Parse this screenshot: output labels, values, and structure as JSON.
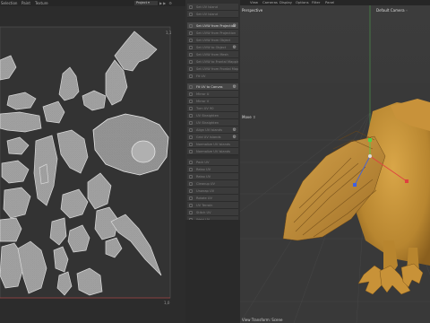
{
  "uv_menu": [
    "Selection",
    "Paint",
    "Texture"
  ],
  "uv_dropdown": "Project",
  "uv_buttons": "▶▶ ⚙",
  "uv_labels": {
    "corner_top": "1,1",
    "corner_bottom": "1,0"
  },
  "tools": [
    {
      "label": "Set UV Island"
    },
    {
      "label": "Set UV Island"
    },
    {
      "label": "Set UVW from Projection",
      "active": true
    },
    {
      "label": "Set UVW from Projection"
    },
    {
      "label": "Set UVW from Object"
    },
    {
      "label": "Set UVW to Object"
    },
    {
      "label": "Set UVW from Mesh"
    },
    {
      "label": "Set UVW to Frontal Mapping"
    },
    {
      "label": "Set UVW from Frontal Mapping"
    },
    {
      "label": "Fit UV"
    },
    {
      "label": "Fit UV to Canvas",
      "active": true
    },
    {
      "label": "Mirror U"
    },
    {
      "label": "Mirror V"
    },
    {
      "label": "Turn UV 90"
    },
    {
      "label": "UV Straighten"
    },
    {
      "label": "UV Straighten"
    },
    {
      "label": "Align UV Islands"
    },
    {
      "label": "Grid UV Islands"
    },
    {
      "label": "Normalize UV Islands"
    },
    {
      "label": "Normalize UV Islands"
    },
    {
      "label": "Pack UV"
    },
    {
      "label": "Relax UV"
    },
    {
      "label": "Relax UV"
    },
    {
      "label": "Cleanup UV"
    },
    {
      "label": "Unwrap UV"
    },
    {
      "label": "Rotate UV"
    },
    {
      "label": "UV Terrain"
    },
    {
      "label": "Stitch UV"
    },
    {
      "label": "Weld UV"
    },
    {
      "label": "Weld UV"
    }
  ],
  "viewport_menu": [
    "View",
    "Cameras",
    "Display",
    "Options",
    "Filter",
    "Panel"
  ],
  "viewport": {
    "projection": "Perspective",
    "camera": "Default Camera ◦",
    "move_label": "Move ⇧",
    "status": "View Transform: Scene"
  }
}
